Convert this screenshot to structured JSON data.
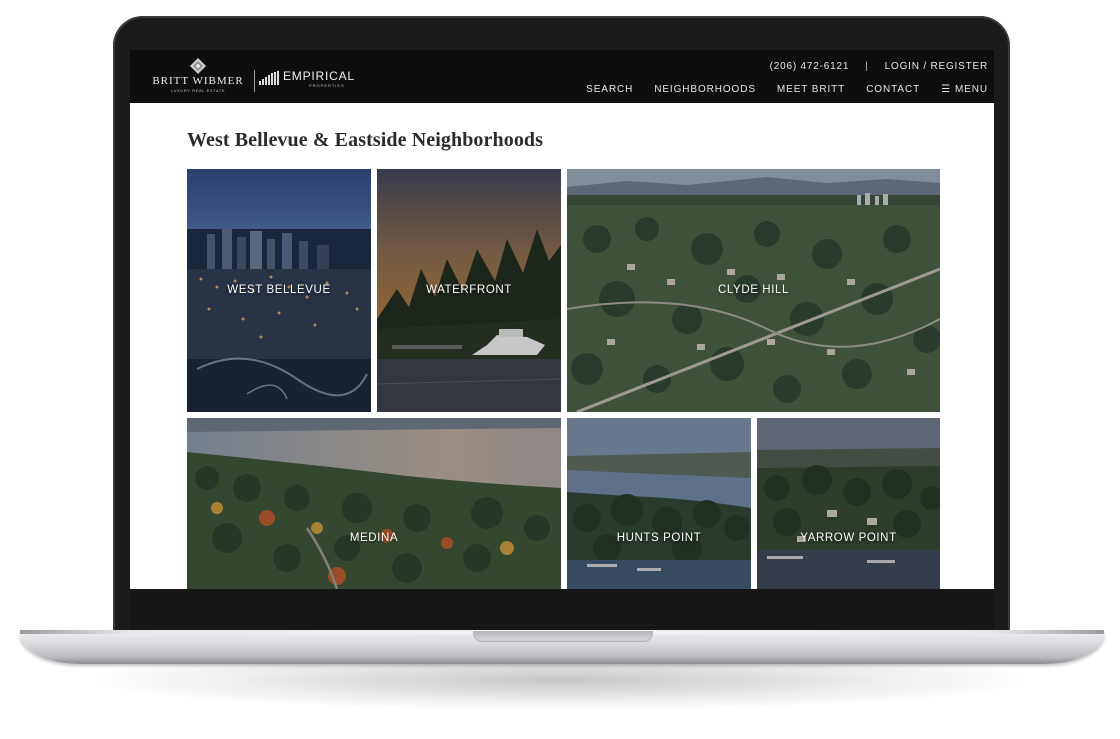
{
  "header": {
    "logo_text": "BRITT WIBMER",
    "logo_tagline": "LUXURY REAL ESTATE",
    "partner_logo_text": "EMPIRICAL",
    "partner_logo_sub": "PROPERTIES"
  },
  "topbar": {
    "phone": "(206) 472-6121",
    "separator": "|",
    "login": "LOGIN / REGISTER"
  },
  "nav": {
    "items": [
      {
        "label": "SEARCH"
      },
      {
        "label": "NEIGHBORHOODS"
      },
      {
        "label": "MEET BRITT"
      },
      {
        "label": "CONTACT"
      }
    ],
    "menu_icon": "hamburger-icon",
    "menu_label": "MENU"
  },
  "page": {
    "title": "West Bellevue & Eastside Neighborhoods"
  },
  "neighborhoods": [
    {
      "label": "WEST BELLEVUE"
    },
    {
      "label": "WATERFRONT"
    },
    {
      "label": "CLYDE HILL"
    },
    {
      "label": "MEDINA"
    },
    {
      "label": "HUNTS POINT"
    },
    {
      "label": "YARROW POINT"
    }
  ]
}
